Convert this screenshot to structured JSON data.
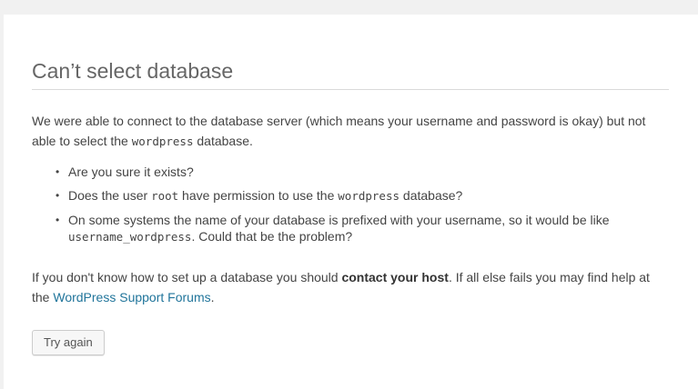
{
  "error": {
    "title": "Can’t select database",
    "intro_part1": "We were able to connect to the database server (which means your username and password is okay) but not able to select the ",
    "intro_code": "wordpress",
    "intro_part2": " database.",
    "bullets": [
      {
        "text1": "Are you sure it exists?"
      },
      {
        "text1": "Does the user ",
        "code1": "root",
        "text2": " have permission to use the ",
        "code2": "wordpress",
        "text3": " database?"
      },
      {
        "text1": "On some systems the name of your database is prefixed with your username, so it would be like ",
        "code1": "username_wordpress",
        "text2": ". Could that be the problem?"
      }
    ],
    "help_part1": "If you don't know how to set up a database you should ",
    "help_bold": "contact your host",
    "help_part2": ". If all else fails you may find help at the ",
    "help_link": "WordPress Support Forums",
    "help_end": ".",
    "retry_button": "Try again"
  }
}
